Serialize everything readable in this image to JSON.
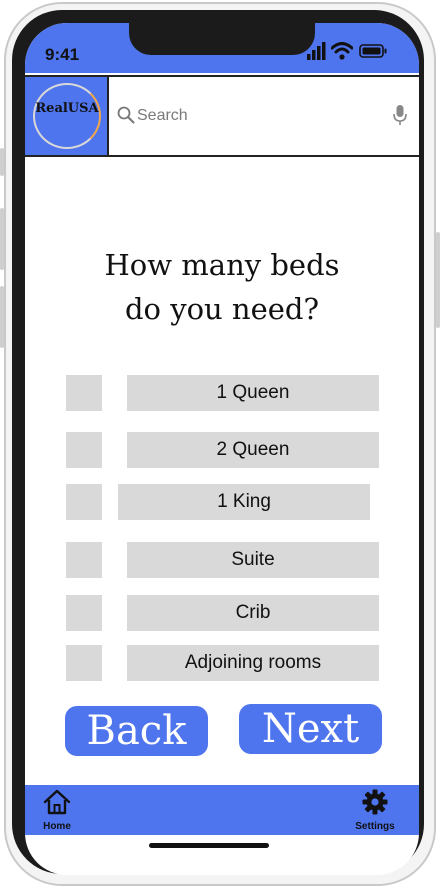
{
  "status_bar": {
    "time": "9:41"
  },
  "header": {
    "logo_text": "RealUSA",
    "search": {
      "placeholder": "Search",
      "value": ""
    }
  },
  "question": {
    "line1": "How many beds",
    "line2": "do  you need?"
  },
  "options": [
    {
      "label": "1 Queen"
    },
    {
      "label": "2 Queen"
    },
    {
      "label": "1 King"
    },
    {
      "label": "Suite"
    },
    {
      "label": "Crib"
    },
    {
      "label": "Adjoining rooms"
    }
  ],
  "buttons": {
    "back": "Back",
    "next": "Next"
  },
  "tab_bar": {
    "home": "Home",
    "settings": "Settings"
  },
  "colors": {
    "accent": "#4e74ee",
    "option_fill": "#d9d9d9"
  }
}
